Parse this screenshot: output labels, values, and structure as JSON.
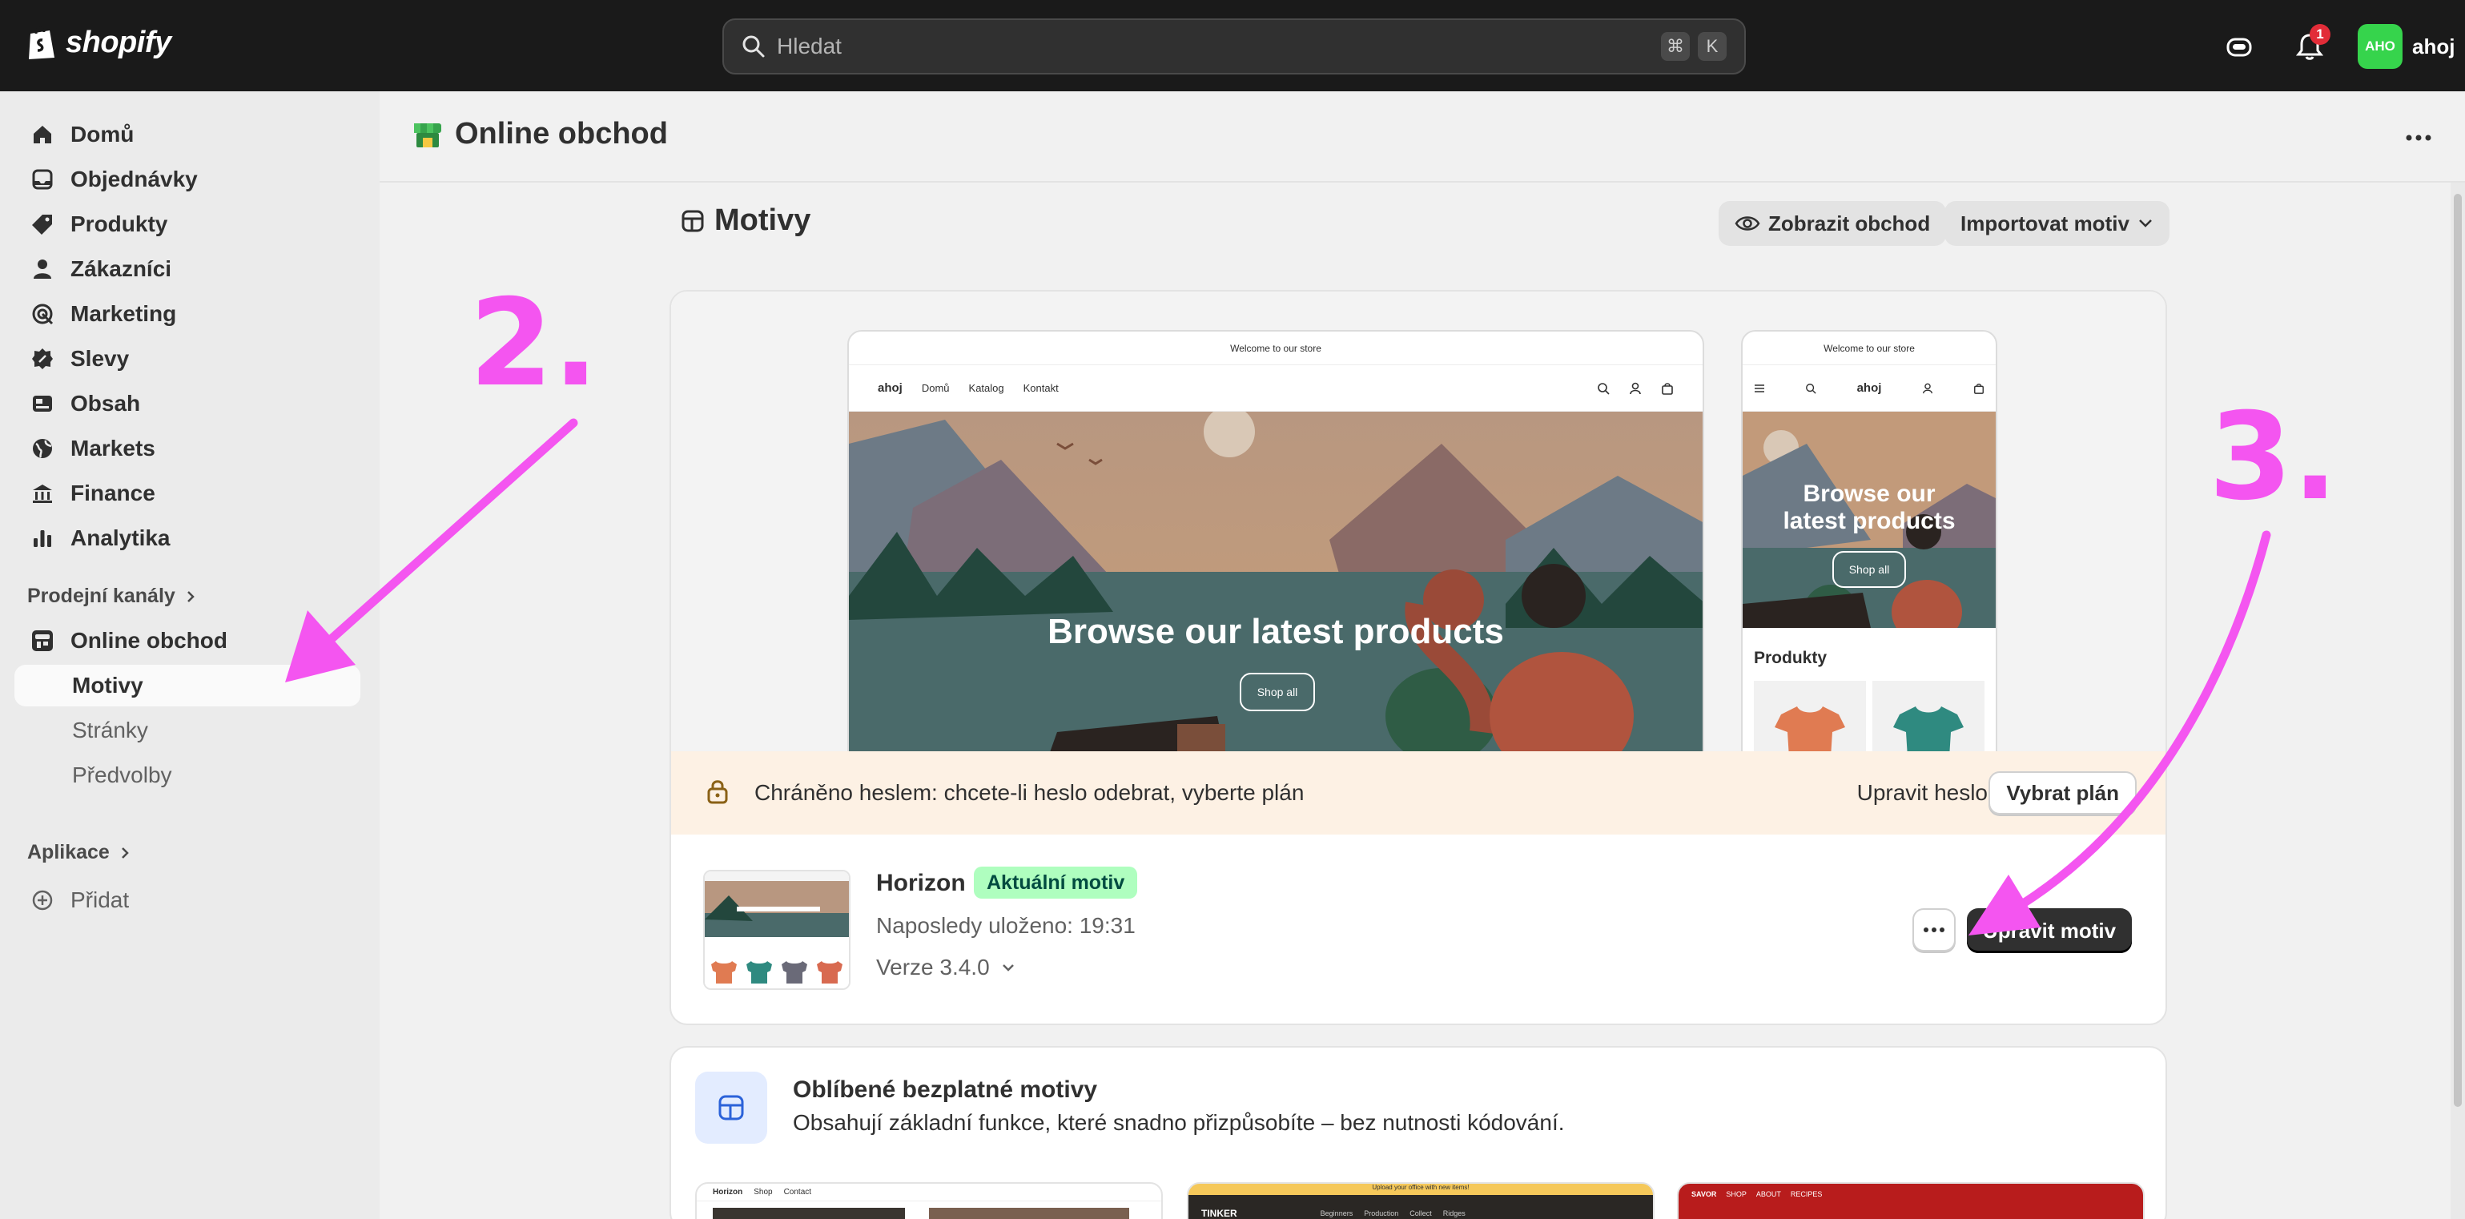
{
  "topbar": {
    "brand": "shopify",
    "search_placeholder": "Hledat",
    "shortcut_keys": [
      "⌘",
      "K"
    ],
    "notifications_count": "1",
    "user_initials": "AHO",
    "user_name": "ahoj",
    "avatar_color": "#36d44c"
  },
  "sidebar": {
    "items": [
      {
        "label": "Domů",
        "icon": "home-icon"
      },
      {
        "label": "Objednávky",
        "icon": "inbox-icon"
      },
      {
        "label": "Produkty",
        "icon": "tag-icon"
      },
      {
        "label": "Zákazníci",
        "icon": "person-icon"
      },
      {
        "label": "Marketing",
        "icon": "target-icon"
      },
      {
        "label": "Slevy",
        "icon": "discount-icon"
      },
      {
        "label": "Obsah",
        "icon": "content-icon"
      },
      {
        "label": "Markets",
        "icon": "globe-icon"
      },
      {
        "label": "Finance",
        "icon": "bank-icon"
      },
      {
        "label": "Analytika",
        "icon": "chart-bar-icon"
      }
    ],
    "sales_channels_label": "Prodejní kanály",
    "online_store_label": "Online obchod",
    "sub_items": [
      "Motivy",
      "Stránky",
      "Předvolby"
    ],
    "apps_label": "Aplikace",
    "add_label": "Přidat"
  },
  "header": {
    "title": "Online obchod"
  },
  "themes": {
    "heading": "Motivy",
    "view_store": "Zobrazit obchod",
    "import_theme": "Importovat motiv"
  },
  "preview": {
    "announcement": "Welcome to our store",
    "store_name": "ahoj",
    "nav_links": [
      "Domů",
      "Katalog",
      "Kontakt"
    ],
    "hero_title": "Browse our latest products",
    "mobile_hero_title_line1": "Browse our",
    "mobile_hero_title_line2": "latest products",
    "shop_all": "Shop all",
    "products_heading": "Produkty"
  },
  "notice": {
    "text": "Chráněno heslem: chcete-li heslo odebrat, vyberte plán",
    "edit_password": "Upravit heslo",
    "choose_plan": "Vybrat plán"
  },
  "current_theme": {
    "name": "Horizon",
    "badge": "Aktuální motiv",
    "last_saved": "Naposledy uloženo: 19:31",
    "version": "Verze 3.4.0",
    "edit_button": "Upravit motiv"
  },
  "free_themes": {
    "title": "Oblíbené bezplatné motivy",
    "subtitle": "Obsahují základní funkce, které snadno přizpůsobíte – bez nutnosti kódování.",
    "previews": [
      {
        "brand": "Horizon",
        "links": [
          "Shop",
          "Contact"
        ]
      },
      {
        "brand": "TINKER",
        "banner": "Upload your office with new items!",
        "links": [
          "Beginners",
          "Production",
          "Collect",
          "Ridges"
        ]
      },
      {
        "brand": "SAVOR",
        "links": [
          "SHOP",
          "ABOUT",
          "RECIPES"
        ]
      }
    ]
  },
  "annotations": [
    "2.",
    "3."
  ],
  "colors": {
    "annotation": "#f455f0",
    "topbar": "#1a1a1a",
    "badge_bg": "#affebf",
    "notice_bg": "#fdf1e4"
  }
}
